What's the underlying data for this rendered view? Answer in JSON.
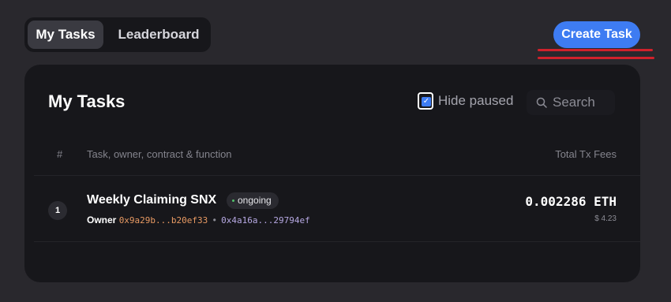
{
  "tabs": [
    {
      "label": "My Tasks",
      "active": true
    },
    {
      "label": "Leaderboard",
      "active": false
    }
  ],
  "create_button": {
    "label": "Create Task"
  },
  "panel": {
    "title": "My Tasks",
    "hide_paused": {
      "label": "Hide paused",
      "checked": true
    },
    "search": {
      "placeholder": "Search",
      "value": ""
    },
    "table": {
      "headers": {
        "num": "#",
        "task": "Task, owner, contract & function",
        "fees": "Total Tx Fees"
      },
      "rows": [
        {
          "num": "1",
          "name": "Weekly Claiming SNX",
          "status": "ongoing",
          "owner_label": "Owner",
          "owner_address": "0x9a29b...b20ef33",
          "separator": "•",
          "contract_address": "0x4a16a...29794ef",
          "fee_eth": "0.002286 ETH",
          "fee_usd": "$ 4.23"
        }
      ]
    }
  },
  "colors": {
    "accent": "#3e7cf2",
    "background": "#29282d",
    "panel": "#17171b",
    "owner_address": "#e89a63",
    "contract_address": "#b7a9e3",
    "status_dot": "#52c16b",
    "annotation": "#d0212b"
  },
  "icons": {
    "search": "search-icon",
    "status": "status-dot-icon",
    "checkbox": "check-icon"
  }
}
